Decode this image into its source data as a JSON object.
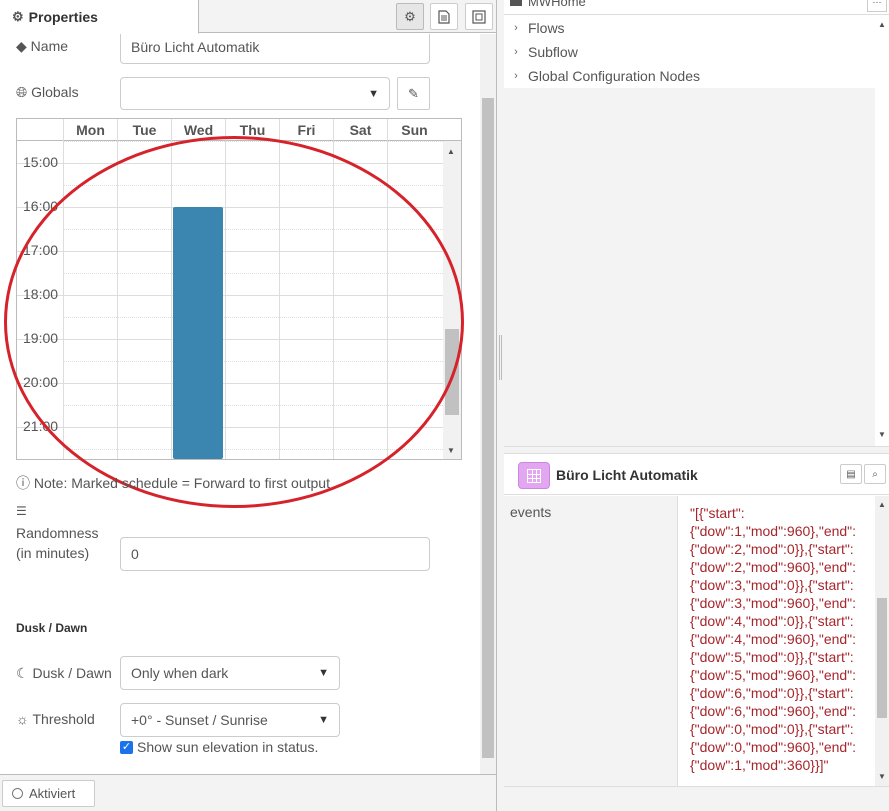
{
  "properties_tab": {
    "label": "Properties"
  },
  "form": {
    "name_label": "Name",
    "name_value": "Büro Licht Automatik",
    "globals_label": "Globals",
    "globals_value": "",
    "note": "Note: Marked schedule = Forward to first output",
    "randomness_label_1": "Randomness",
    "randomness_label_2": "(in minutes)",
    "randomness_value": "0",
    "section_dusk": "Dusk / Dawn",
    "dusk_label": "Dusk / Dawn",
    "dusk_value": "Only when dark",
    "threshold_label": "Threshold",
    "threshold_value": "+0° - Sunset / Sunrise",
    "show_sun_label": "Show sun elevation in status.",
    "show_sun_checked": true
  },
  "schedule": {
    "days": [
      "Mon",
      "Tue",
      "Wed",
      "Thu",
      "Fri",
      "Sat",
      "Sun"
    ],
    "hours": [
      "15:00",
      "16:00",
      "17:00",
      "18:00",
      "19:00",
      "20:00",
      "21:00"
    ]
  },
  "footer": {
    "activated_label": "Aktiviert"
  },
  "tree": {
    "top_label": "MWHome",
    "items": [
      "Flows",
      "Subflow",
      "Global Configuration Nodes"
    ]
  },
  "info": {
    "node_title": "Büro Licht Automatik",
    "prop_key": "events",
    "prop_value": "\"[{\"start\":\n{\"dow\":1,\"mod\":960},\"end\":\n{\"dow\":2,\"mod\":0}},{\"start\":\n{\"dow\":2,\"mod\":960},\"end\":\n{\"dow\":3,\"mod\":0}},{\"start\":\n{\"dow\":3,\"mod\":960},\"end\":\n{\"dow\":4,\"mod\":0}},{\"start\":\n{\"dow\":4,\"mod\":960},\"end\":\n{\"dow\":5,\"mod\":0}},{\"start\":\n{\"dow\":5,\"mod\":960},\"end\":\n{\"dow\":6,\"mod\":0}},{\"start\":\n{\"dow\":6,\"mod\":960},\"end\":\n{\"dow\":0,\"mod\":0}},{\"start\":\n{\"dow\":0,\"mod\":960},\"end\":\n{\"dow\":1,\"mod\":360}}]\""
  },
  "colors": {
    "schedule_mark": "#3a86b0",
    "annotation_circle": "#d6222a",
    "value_text": "#a7262c",
    "node_icon": "#e2a7f0"
  },
  "icons": {
    "properties": "gear-icon",
    "globals": "globe-icon",
    "edit": "pencil-icon",
    "note": "info-circle-icon",
    "randomness": "list-icon",
    "dusk": "moon-icon",
    "threshold": "sun-icon",
    "node": "calendar-icon"
  }
}
